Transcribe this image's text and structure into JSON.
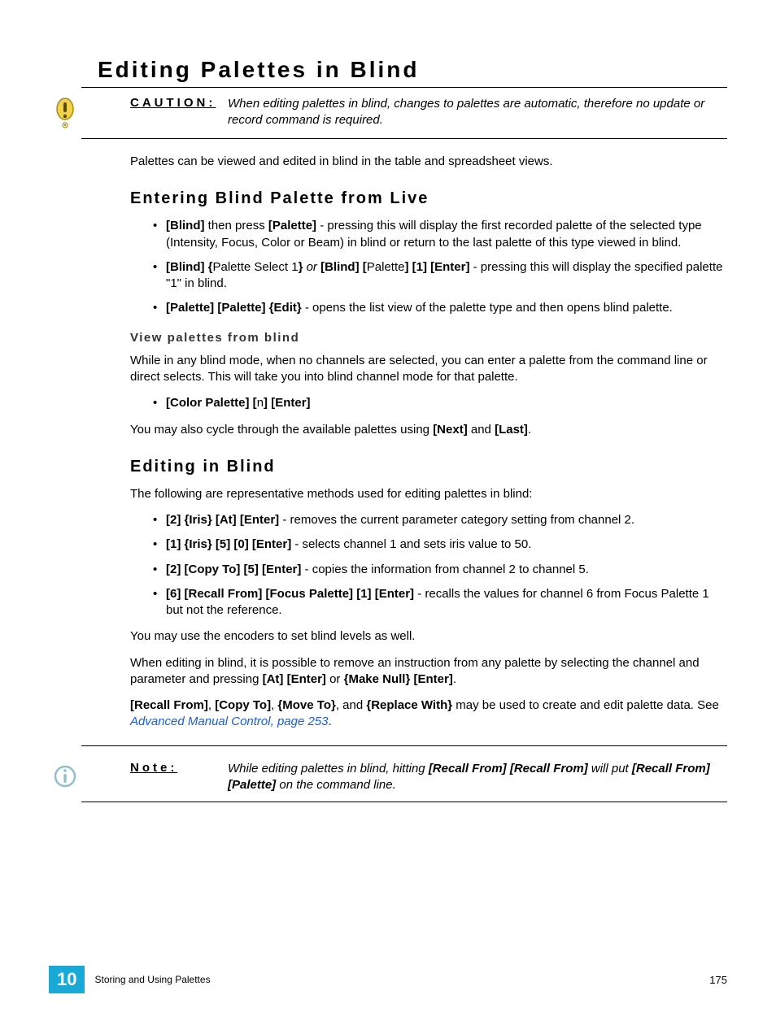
{
  "title": "Editing Palettes in Blind",
  "caution": {
    "label": "CAUTION:",
    "text": "When editing palettes in blind, changes to palettes are automatic, therefore no update or record command is required."
  },
  "intro": "Palettes can be viewed and edited in blind in the table and spreadsheet views.",
  "section1": {
    "heading": "Entering Blind Palette from Live",
    "items": {
      "i0_a": "[Blind]",
      "i0_b": " then press ",
      "i0_c": "[Palette]",
      "i0_d": " - pressing this will display the first recorded palette of the selected type (Intensity, Focus, Color or Beam) in blind or return to the last palette of this type viewed in blind.",
      "i1_a": "[Blind] {",
      "i1_b": "Palette Select 1",
      "i1_c": "}",
      "i1_d": " or ",
      "i1_e": "[Blind] [",
      "i1_f": "Palette",
      "i1_g": "] [1] [Enter]",
      "i1_h": " - pressing this will display the specified palette \"1\" in blind.",
      "i2_a": "[Palette] [Palette] {Edit}",
      "i2_b": " - opens the list view of the palette type and then opens blind palette."
    },
    "sub": {
      "heading": "View palettes from blind",
      "p1": "While in any blind mode, when no channels are selected, you can enter a palette from the command line or direct selects. This will take you into blind channel mode for that palette.",
      "li_a": "[Color Palette] [",
      "li_b": "n",
      "li_c": "] [Enter]",
      "p2_a": "You may also cycle through the available palettes using ",
      "p2_b": "[Next]",
      "p2_c": " and ",
      "p2_d": "[Last]",
      "p2_e": "."
    }
  },
  "section2": {
    "heading": "Editing in Blind",
    "intro": "The following are representative methods used for editing palettes in blind:",
    "items": {
      "i0_a": "[2] {Iris} [At] [Enter]",
      "i0_b": " - removes the current parameter category setting from channel 2.",
      "i1_a": "[1] {Iris} [5] [0] [Enter]",
      "i1_b": " - selects channel 1 and sets iris value to 50.",
      "i2_a": "[2] [Copy To] [5] [Enter]",
      "i2_b": " - copies the information from channel 2 to channel 5.",
      "i3_a": "[6] [Recall From] [Focus Palette] [1] [Enter]",
      "i3_b": " - recalls the values for channel 6 from Focus Palette 1 but not the reference."
    },
    "p1": "You may use the encoders to set blind levels as well.",
    "p2_a": "When editing in blind, it is possible to remove an instruction from any palette by selecting the channel and parameter and pressing ",
    "p2_b": "[At] [Enter]",
    "p2_c": " or ",
    "p2_d": "{Make Null} [Enter]",
    "p2_e": ".",
    "p3_a": "[Recall From]",
    "p3_b": ", ",
    "p3_c": "[Copy To]",
    "p3_d": ", ",
    "p3_e": "{Move To}",
    "p3_f": ", and ",
    "p3_g": "{Replace With}",
    "p3_h": " may be used to create and edit palette data. See ",
    "p3_link": "Advanced Manual Control, page 253",
    "p3_i": "."
  },
  "note": {
    "label": "Note:",
    "t1": "While editing palettes in blind, hitting ",
    "t2": "[Recall From] [Recall From]",
    "t3": " will put ",
    "t4": "[Recall From] [Palette]",
    "t5": " on the command line."
  },
  "footer": {
    "chapter": "10",
    "title": "Storing and Using Palettes",
    "page": "175"
  }
}
